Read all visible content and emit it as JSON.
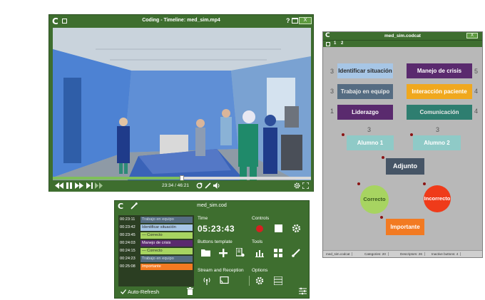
{
  "colors": {
    "window_green": "#3e6e2f",
    "close_green": "#5d9a3f",
    "cat_blue_light": "#a7c6e6",
    "cat_purple": "#5a2a6e",
    "cat_slate": "#556c82",
    "cat_orange": "#f0a81e",
    "cat_teal": "#2e7e70",
    "cat_aqua": "#8fcac7",
    "cat_dark_slate": "#465566",
    "correct_green": "#a7d461",
    "incorrect_red": "#ef3b1a",
    "important_orange": "#f27a22"
  },
  "video_window": {
    "logo": "C",
    "title": "Coding -   Timeline: med_sim.mp4",
    "help": "?",
    "close_label": "X",
    "progress_fraction": 0.5,
    "time_display": "23:34 / 46:21",
    "icons": [
      "rewind-icon",
      "pause-icon",
      "fast-forward-icon",
      "next-frame-icon",
      "loop-icon",
      "edit-icon",
      "volume-icon",
      "settings-icon",
      "fullscreen-icon"
    ]
  },
  "codcat": {
    "logo": "C",
    "title": "med_sim.codcat",
    "close_label": "X",
    "tabs": [
      "1",
      "2"
    ],
    "buttons": [
      {
        "label": "Identificar situación",
        "color": "#a7c6e6",
        "text": "#2a2a2a"
      },
      {
        "label": "Manejo de crisis",
        "color": "#5a2a6e",
        "text": "#ffffff"
      },
      {
        "label": "Trabajo en equipo",
        "color": "#556c82",
        "text": "#e8e8e8"
      },
      {
        "label": "Interacción paciente",
        "color": "#f0a81e",
        "text": "#ffffff"
      },
      {
        "label": "Liderazgo",
        "color": "#5a2a6e",
        "text": "#ffffff"
      },
      {
        "label": "Comunicación",
        "color": "#2e7e70",
        "text": "#e8e8e8"
      },
      {
        "label": "Alumno 1",
        "color": "#8fcac7",
        "text": "#ffffff"
      },
      {
        "label": "Alumno 2",
        "color": "#8fcac7",
        "text": "#ffffff"
      },
      {
        "label": "Adjunto",
        "color": "#465566",
        "text": "#ffffff"
      },
      {
        "label": "Correcto",
        "color": "#a7d461",
        "text": "#3a5a1e"
      },
      {
        "label": "Incorrecto",
        "color": "#ef3b1a",
        "text": "#ffffff"
      },
      {
        "label": "Importante",
        "color": "#f27a22",
        "text": "#ffffff"
      }
    ],
    "numbers": [
      "3",
      "5",
      "3",
      "4",
      "1",
      "4",
      "3",
      "3"
    ],
    "status": [
      "med_sim.codcat",
      "Categories: 20",
      "Descriptors: 26",
      "Inactive buttons: 4"
    ]
  },
  "coding_panel": {
    "logo": "C",
    "title": "med_sim.cod",
    "events": [
      {
        "time": "00:23:11",
        "label": "Trabajo en equipo",
        "color": "#556c82",
        "text": "#cfdbe6"
      },
      {
        "time": "00:23:42",
        "label": "Identificar situación",
        "color": "#a7c6e6",
        "text": "#2a2a2a"
      },
      {
        "time": "00:23:45",
        "label": "— Correcto",
        "color": "#a7d461",
        "text": "#2a2a2a"
      },
      {
        "time": "00:24:03",
        "label": "Manejo de crisis",
        "color": "#5a2a6e",
        "text": "#ffffff"
      },
      {
        "time": "00:24:15",
        "label": "— Correcto",
        "color": "#a7d461",
        "text": "#2a2a2a"
      },
      {
        "time": "00:24:23",
        "label": "Trabajo en equipo",
        "color": "#556c82",
        "text": "#cfdbe6"
      },
      {
        "time": "00:25:08",
        "label": "Importante",
        "color": "#f27a22",
        "text": "#ffffff"
      }
    ],
    "time_label": "Time",
    "time_value": "05:23:43",
    "controls_label": "Controls",
    "buttons_template_label": "Buttons template",
    "tools_label": "Tools",
    "stream_label": "Stream and Reception",
    "options_label": "Options",
    "auto_refresh_label": "Auto-Refresh"
  }
}
